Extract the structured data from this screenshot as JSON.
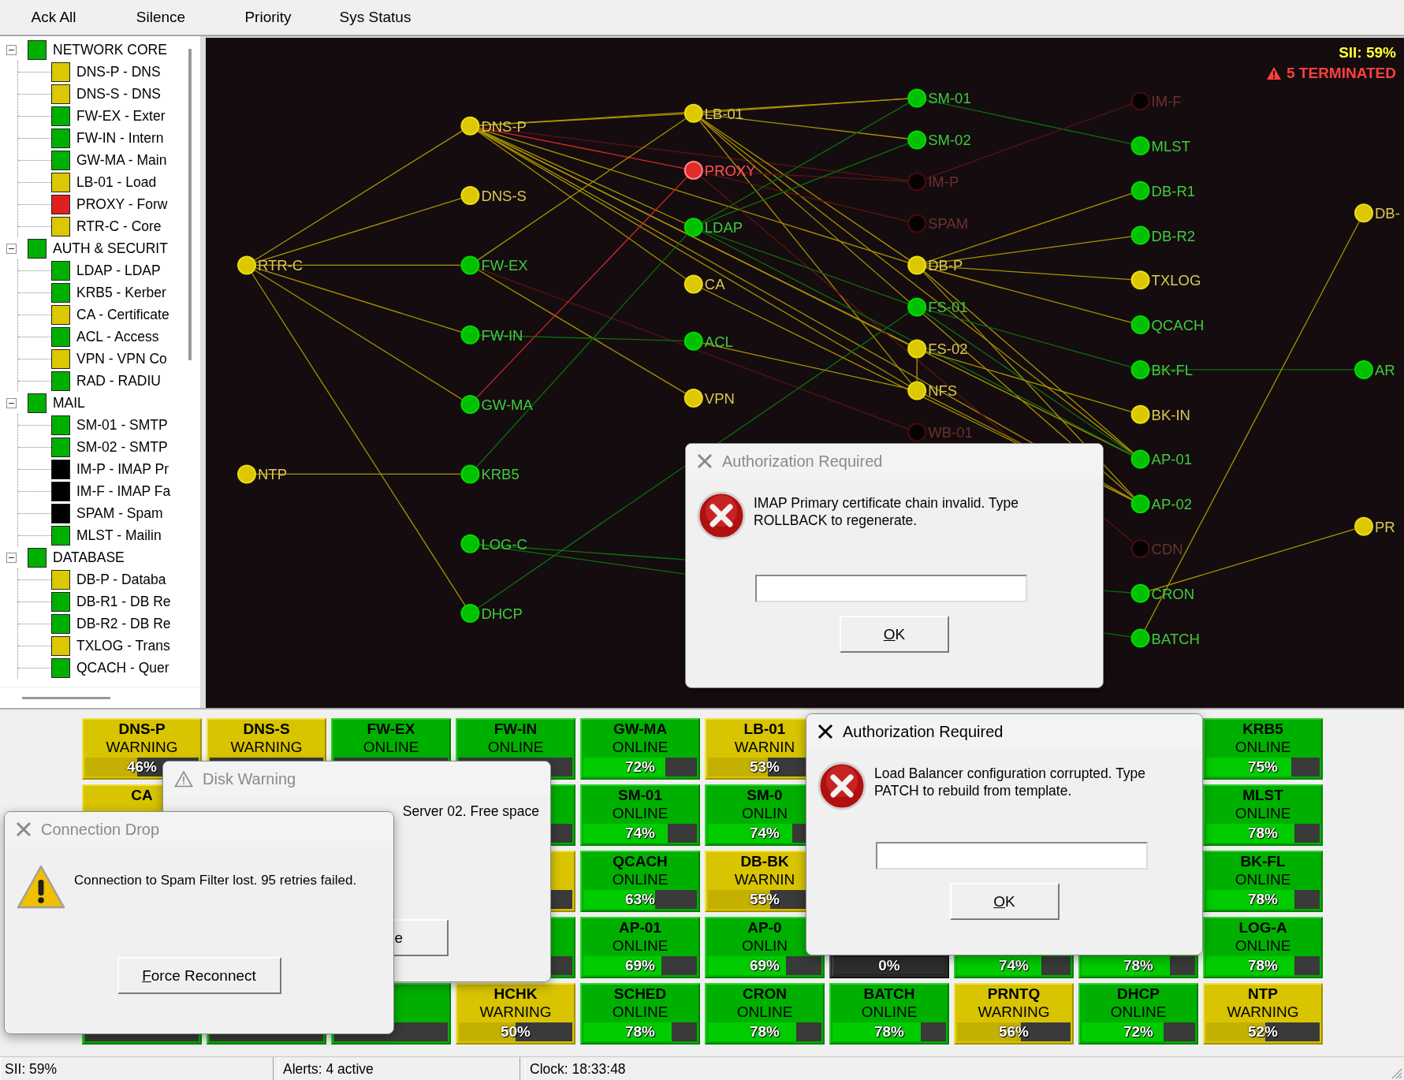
{
  "menu": [
    {
      "label": "Ack All"
    },
    {
      "label": "Silence"
    },
    {
      "label": "Priority"
    },
    {
      "label": "Sys Status"
    }
  ],
  "tree": [
    {
      "label": "NETWORK CORE",
      "color": "#00b000",
      "expanded": true,
      "children": [
        {
          "label": "DNS-P - DNS",
          "color": "#dcc800"
        },
        {
          "label": "DNS-S - DNS",
          "color": "#dcc800"
        },
        {
          "label": "FW-EX - Exter",
          "color": "#00b000"
        },
        {
          "label": "FW-IN - Intern",
          "color": "#00b000"
        },
        {
          "label": "GW-MA - Main",
          "color": "#00b000"
        },
        {
          "label": "LB-01 - Load",
          "color": "#dcc800"
        },
        {
          "label": "PROXY - Forw",
          "color": "#e02020"
        },
        {
          "label": "RTR-C - Core",
          "color": "#dcc800"
        }
      ]
    },
    {
      "label": "AUTH & SECURIT",
      "color": "#00b000",
      "expanded": true,
      "children": [
        {
          "label": "LDAP - LDAP",
          "color": "#00b000"
        },
        {
          "label": "KRB5 - Kerber",
          "color": "#00b000"
        },
        {
          "label": "CA - Certificate",
          "color": "#dcc800"
        },
        {
          "label": "ACL - Access",
          "color": "#00b000"
        },
        {
          "label": "VPN - VPN Co",
          "color": "#dcc800"
        },
        {
          "label": "RAD - RADIU",
          "color": "#00b000"
        }
      ]
    },
    {
      "label": "MAIL",
      "color": "#00b000",
      "expanded": true,
      "children": [
        {
          "label": "SM-01 - SMTP",
          "color": "#00b000"
        },
        {
          "label": "SM-02 - SMTP",
          "color": "#00b000"
        },
        {
          "label": "IM-P - IMAP Pr",
          "color": "#000000"
        },
        {
          "label": "IM-F - IMAP Fa",
          "color": "#000000"
        },
        {
          "label": "SPAM - Spam",
          "color": "#000000"
        },
        {
          "label": "MLST - Mailin",
          "color": "#00b000"
        }
      ]
    },
    {
      "label": "DATABASE",
      "color": "#00b000",
      "expanded": true,
      "children": [
        {
          "label": "DB-P - Databa",
          "color": "#dcc800"
        },
        {
          "label": "DB-R1 - DB Re",
          "color": "#00b000"
        },
        {
          "label": "DB-R2 - DB Re",
          "color": "#00b000"
        },
        {
          "label": "TXLOG - Trans",
          "color": "#dcc800"
        },
        {
          "label": "QCACH - Quer",
          "color": "#00b000"
        }
      ]
    }
  ],
  "graph": {
    "sii": "SII: 59%",
    "alert": "5 TERMINATED",
    "columns": [
      [
        {
          "label": "RTR-C",
          "color": "#dcc800"
        },
        {
          "label": "NTP",
          "color": "#dcc800"
        }
      ],
      [
        {
          "label": "DNS-P",
          "color": "#dcc800"
        },
        {
          "label": "DNS-S",
          "color": "#dcc800"
        },
        {
          "label": "FW-EX",
          "color": "#00c000"
        },
        {
          "label": "FW-IN",
          "color": "#00c000"
        },
        {
          "label": "GW-MA",
          "color": "#00c000"
        },
        {
          "label": "KRB5",
          "color": "#00c000"
        },
        {
          "label": "LOG-C",
          "color": "#00c000"
        },
        {
          "label": "DHCP",
          "color": "#00c000"
        }
      ],
      [
        {
          "label": "LB-01",
          "color": "#dcc800"
        },
        {
          "label": "PROXY",
          "color": "#e42a2a"
        },
        {
          "label": "LDAP",
          "color": "#00c000"
        },
        {
          "label": "CA",
          "color": "#dcc800"
        },
        {
          "label": "ACL",
          "color": "#00c000"
        },
        {
          "label": "VPN",
          "color": "#dcc800"
        }
      ],
      [
        {
          "label": "SM-01",
          "color": "#00c000"
        },
        {
          "label": "SM-02",
          "color": "#00c000"
        },
        {
          "label": "IM-P",
          "color": "#060203"
        },
        {
          "label": "SPAM",
          "color": "#060203"
        },
        {
          "label": "DB-P",
          "color": "#dcc800"
        },
        {
          "label": "FS-01",
          "color": "#00c000"
        },
        {
          "label": "FS-02",
          "color": "#dcc800"
        },
        {
          "label": "NFS",
          "color": "#dcc800"
        },
        {
          "label": "WB-01",
          "color": "#060203"
        }
      ],
      [
        {
          "label": "IM-F",
          "color": "#060203"
        },
        {
          "label": "MLST",
          "color": "#00c000"
        },
        {
          "label": "DB-R1",
          "color": "#00c000"
        },
        {
          "label": "DB-R2",
          "color": "#00c000"
        },
        {
          "label": "TXLOG",
          "color": "#dcc800"
        },
        {
          "label": "QCACH",
          "color": "#00c000"
        },
        {
          "label": "BK-FL",
          "color": "#00c000"
        },
        {
          "label": "BK-IN",
          "color": "#dcc800"
        },
        {
          "label": "AP-01",
          "color": "#00c000"
        },
        {
          "label": "AP-02",
          "color": "#00c000"
        },
        {
          "label": "CDN",
          "color": "#060203"
        },
        {
          "label": "CRON",
          "color": "#00c000"
        },
        {
          "label": "BATCH",
          "color": "#00c000"
        }
      ],
      [
        {
          "label": "DB-",
          "color": "#dcc800"
        },
        {
          "label": "AR",
          "color": "#00c000"
        },
        {
          "label": "PR",
          "color": "#dcc800"
        }
      ]
    ]
  },
  "tiles": [
    {
      "name": "DNS-P",
      "state": "WARNING",
      "color": "#d8c400",
      "percent": "46%",
      "level": 0.46
    },
    {
      "name": "DNS-S",
      "state": "WARNING",
      "color": "#d8c400"
    },
    {
      "name": "FW-EX",
      "state": "ONLINE",
      "color": "#00b000"
    },
    {
      "name": "FW-IN",
      "state": "ONLINE",
      "color": "#00b000"
    },
    {
      "name": "GW-MA",
      "state": "ONLINE",
      "color": "#00b000",
      "percent": "72%",
      "level": 0.72
    },
    {
      "name": "LB-01",
      "state": "WARNIN",
      "color": "#d8c400",
      "percent": "53%",
      "level": 0.53
    },
    {
      "name": "KRB5",
      "state": "ONLINE",
      "color": "#00b000",
      "percent": "75%",
      "level": 0.75
    },
    {
      "name": "CA",
      "color": "#d8c400"
    },
    {
      "color": "#00b000"
    },
    {
      "name": "SM-01",
      "state": "ONLINE",
      "color": "#00b000",
      "percent": "74%",
      "level": 0.74
    },
    {
      "name": "SM-0",
      "state": "ONLIN",
      "color": "#00b000",
      "percent": "74%",
      "level": 0.74
    },
    {
      "name": "MLST",
      "state": "ONLINE",
      "color": "#00b000",
      "percent": "78%",
      "level": 0.78
    },
    {
      "color": "#d8c400"
    },
    {
      "name": "QCACH",
      "state": "ONLINE",
      "color": "#00b000",
      "percent": "63%",
      "level": 0.63
    },
    {
      "name": "DB-BK",
      "state": "WARNIN",
      "color": "#d8c400",
      "percent": "55%",
      "level": 0.55
    },
    {
      "name": "BK-FL",
      "state": "ONLINE",
      "color": "#00b000",
      "percent": "78%",
      "level": 0.78
    },
    {
      "color": "#00b000"
    },
    {
      "name": "AP-01",
      "state": "ONLINE",
      "color": "#00b000",
      "percent": "69%",
      "level": 0.69
    },
    {
      "name": "AP-0",
      "state": "ONLIN",
      "color": "#00b000",
      "percent": "69%",
      "level": 0.69
    },
    {
      "color": "#2e2e2e",
      "percent": "0%",
      "level": 0
    },
    {
      "color": "#00b000",
      "percent": "74%",
      "level": 0.74
    },
    {
      "color": "#00b000",
      "percent": "78%",
      "level": 0.78
    },
    {
      "name": "LOG-A",
      "state": "ONLINE",
      "color": "#00b000",
      "percent": "78%",
      "level": 0.78
    },
    {
      "color": "#00b000"
    },
    {
      "color": "#00b000"
    },
    {
      "color": "#00b000"
    },
    {
      "name": "HCHK",
      "state": "WARNING",
      "color": "#d8c400",
      "percent": "50%",
      "level": 0.5
    },
    {
      "name": "SCHED",
      "state": "ONLINE",
      "color": "#00b000",
      "percent": "78%",
      "level": 0.78
    },
    {
      "name": "CRON",
      "state": "ONLINE",
      "color": "#00b000",
      "percent": "78%",
      "level": 0.78
    },
    {
      "name": "BATCH",
      "state": "ONLINE",
      "color": "#00b000",
      "percent": "78%",
      "level": 0.78
    },
    {
      "name": "PRNTQ",
      "state": "WARNING",
      "color": "#d8c400",
      "percent": "56%",
      "level": 0.56
    },
    {
      "name": "DHCP",
      "state": "ONLINE",
      "color": "#00b000",
      "percent": "72%",
      "level": 0.72
    },
    {
      "name": "NTP",
      "state": "WARNING",
      "color": "#d8c400",
      "percent": "52%",
      "level": 0.52
    }
  ],
  "dialogs": [
    {
      "kind": "error",
      "title": "Authorization Required",
      "active": false,
      "message": "IMAP Primary certificate chain invalid. Type ROLLBACK to regenerate.",
      "has_input": true,
      "buttons": [
        {
          "label": "OK",
          "mnemonic": true
        }
      ]
    },
    {
      "kind": "error",
      "title": "Authorization Required",
      "active": true,
      "message": "Load Balancer configuration corrupted. Type PATCH to rebuild from template.",
      "has_input": true,
      "buttons": [
        {
          "label": "OK",
          "mnemonic": true
        }
      ]
    },
    {
      "kind": "notice",
      "title": "Disk Warning",
      "active": false,
      "message": "Server 02. Free space",
      "buttons": [
        {
          "label": "e",
          "mnemonic": false
        }
      ]
    },
    {
      "kind": "alert",
      "title": "Connection Drop",
      "active": false,
      "message": "Connection to Spam Filter lost. 95 retries failed.",
      "buttons": [
        {
          "label": "Force Reconnect",
          "mnemonic": true
        }
      ]
    }
  ],
  "status_bar": [
    "SII: 59%",
    "Alerts: 4 active",
    "Clock: 18:33:48"
  ]
}
